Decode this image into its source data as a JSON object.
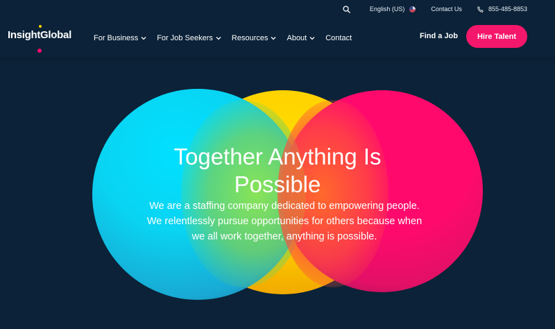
{
  "utility": {
    "language": "English (US)",
    "contact": "Contact Us",
    "phone": "855-485-8853"
  },
  "brand": {
    "logo_text": "InsightGlobal",
    "colors": {
      "background": "#0b2238",
      "accent": "#f5176b",
      "cyan": "#09d4f2",
      "yellow": "#ffd200",
      "pink": "#ff0a6c"
    }
  },
  "nav": {
    "items": [
      {
        "label": "For Business"
      },
      {
        "label": "For Job Seekers"
      },
      {
        "label": "Resources"
      },
      {
        "label": "About"
      },
      {
        "label": "Contact"
      }
    ],
    "find_job": "Find a Job",
    "hire_talent": "Hire Talent"
  },
  "hero": {
    "title": "Together Anything Is Possible",
    "subtitle": "We are a staffing company dedicated to empowering people. We relentlessly pursue opportunities for others because when we all work together, anything is possible."
  },
  "icons": [
    "search-icon",
    "flag-icon",
    "phone-icon",
    "chevron-down-icon"
  ]
}
